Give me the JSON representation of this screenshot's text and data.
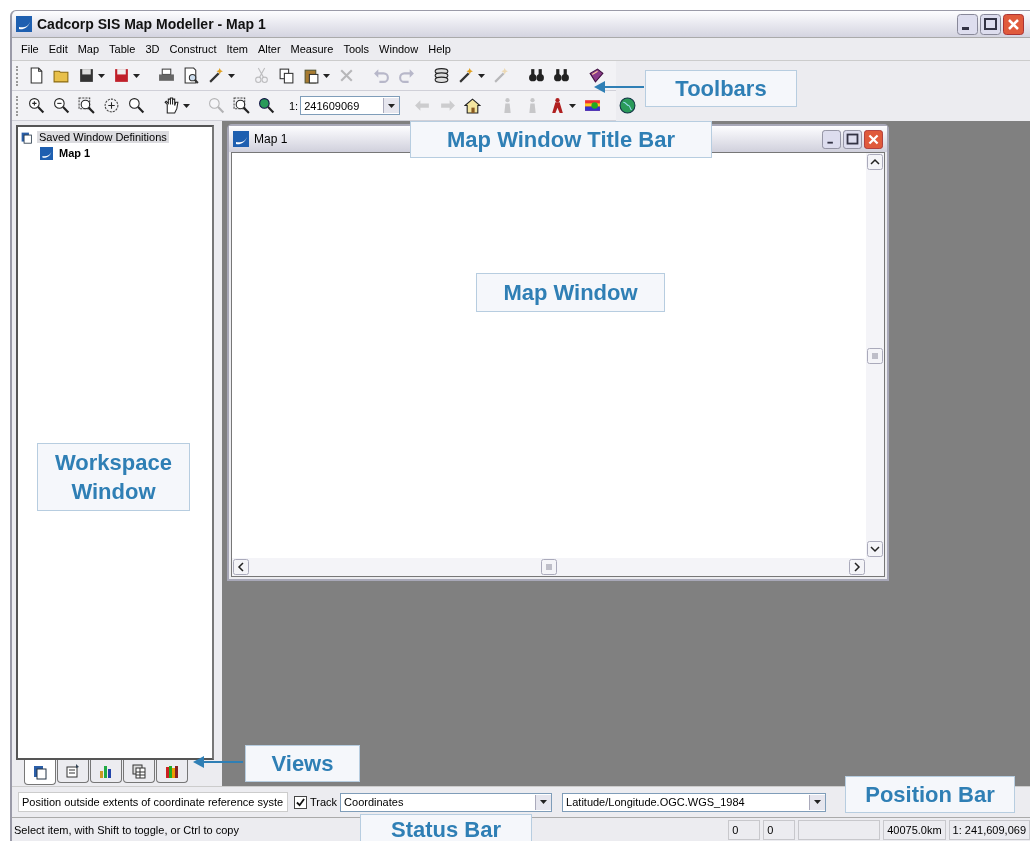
{
  "window": {
    "title": "Cadcorp SIS Map Modeller - Map 1"
  },
  "menu": [
    "File",
    "Edit",
    "Map",
    "Table",
    "3D",
    "Construct",
    "Item",
    "Alter",
    "Measure",
    "Tools",
    "Window",
    "Help"
  ],
  "toolbars": [
    [
      {
        "kind": "button",
        "disabled": false,
        "dropdown": false
      },
      {
        "kind": "button",
        "disabled": false,
        "dropdown": false
      },
      {
        "kind": "button",
        "disabled": false,
        "dropdown": true
      },
      {
        "kind": "button",
        "disabled": false,
        "dropdown": true
      },
      {
        "kind": "separator"
      },
      {
        "kind": "button",
        "disabled": false,
        "dropdown": false
      },
      {
        "kind": "button",
        "disabled": false,
        "dropdown": false
      },
      {
        "kind": "button",
        "disabled": false,
        "dropdown": true
      },
      {
        "kind": "separator"
      },
      {
        "kind": "button",
        "disabled": true,
        "dropdown": false
      },
      {
        "kind": "button",
        "disabled": false,
        "dropdown": false
      },
      {
        "kind": "button",
        "disabled": false,
        "dropdown": true
      },
      {
        "kind": "button",
        "disabled": true,
        "dropdown": false
      },
      {
        "kind": "separator"
      },
      {
        "kind": "button",
        "disabled": true,
        "dropdown": false
      },
      {
        "kind": "button",
        "disabled": true,
        "dropdown": false
      },
      {
        "kind": "separator"
      },
      {
        "kind": "button",
        "disabled": false,
        "dropdown": false
      },
      {
        "kind": "button",
        "disabled": false,
        "dropdown": true
      },
      {
        "kind": "button",
        "disabled": true,
        "dropdown": false
      },
      {
        "kind": "separator"
      },
      {
        "kind": "button",
        "disabled": false,
        "dropdown": false
      },
      {
        "kind": "button",
        "disabled": false,
        "dropdown": false
      },
      {
        "kind": "separator"
      },
      {
        "kind": "button",
        "disabled": false,
        "dropdown": false
      },
      {
        "kind": "separator"
      }
    ],
    [
      {
        "kind": "button",
        "disabled": false,
        "dropdown": false
      },
      {
        "kind": "button",
        "disabled": false,
        "dropdown": false
      },
      {
        "kind": "button",
        "disabled": false,
        "dropdown": false
      },
      {
        "kind": "button",
        "disabled": false,
        "dropdown": false
      },
      {
        "kind": "button",
        "disabled": false,
        "dropdown": false
      },
      {
        "kind": "separator"
      },
      {
        "kind": "button",
        "disabled": false,
        "dropdown": true
      },
      {
        "kind": "separator"
      },
      {
        "kind": "button",
        "disabled": true,
        "dropdown": false
      },
      {
        "kind": "button",
        "disabled": false,
        "dropdown": false
      },
      {
        "kind": "button",
        "disabled": false,
        "dropdown": false
      },
      {
        "kind": "separator"
      },
      {
        "kind": "scale",
        "prefix": "1:",
        "value": "241609069"
      },
      {
        "kind": "separator"
      },
      {
        "kind": "button",
        "disabled": true,
        "dropdown": false
      },
      {
        "kind": "button",
        "disabled": true,
        "dropdown": false
      },
      {
        "kind": "button",
        "disabled": false,
        "dropdown": false
      },
      {
        "kind": "separator"
      },
      {
        "kind": "button",
        "disabled": true,
        "dropdown": false
      },
      {
        "kind": "button",
        "disabled": true,
        "dropdown": false
      },
      {
        "kind": "button",
        "disabled": false,
        "dropdown": true
      },
      {
        "kind": "button",
        "disabled": false,
        "dropdown": false
      },
      {
        "kind": "separator"
      },
      {
        "kind": "button",
        "disabled": false,
        "dropdown": false
      }
    ]
  ],
  "workspace": {
    "tree": [
      {
        "label": "Saved Window Definitions",
        "selected": true,
        "active": false,
        "children": [
          {
            "label": "Map 1",
            "selected": false,
            "active": true
          }
        ]
      }
    ],
    "view_tabs": [
      {
        "selected": true
      },
      {
        "selected": false
      },
      {
        "selected": false
      },
      {
        "selected": false
      },
      {
        "selected": false
      }
    ]
  },
  "map_window": {
    "title": "Map 1"
  },
  "position_bar": {
    "message": "Position outside extents of coordinate reference syste",
    "track": {
      "label": "Track",
      "checked": true
    },
    "mode": "Coordinates",
    "crs": "Latitude/Longitude.OGC.WGS_1984"
  },
  "status_bar": {
    "message": "Select item, with Shift to toggle, or Ctrl to copy",
    "panes": [
      {
        "kind": "text",
        "text": "0"
      },
      {
        "kind": "text",
        "text": "0"
      },
      {
        "kind": "blank"
      },
      {
        "kind": "text",
        "text": "40075.0km"
      },
      {
        "kind": "text",
        "text": "1: 241,609,069"
      }
    ]
  },
  "annotations": [
    {
      "text": "Toolbars",
      "arrow": true
    },
    {
      "text": "Map Window Title Bar",
      "arrow": false
    },
    {
      "text": "Map Window",
      "arrow": false
    },
    {
      "text": "Workspace Window",
      "arrow": false
    },
    {
      "text": "Views",
      "arrow": true
    },
    {
      "text": "Position Bar",
      "arrow": false
    },
    {
      "text": "Status Bar",
      "arrow": false
    }
  ]
}
